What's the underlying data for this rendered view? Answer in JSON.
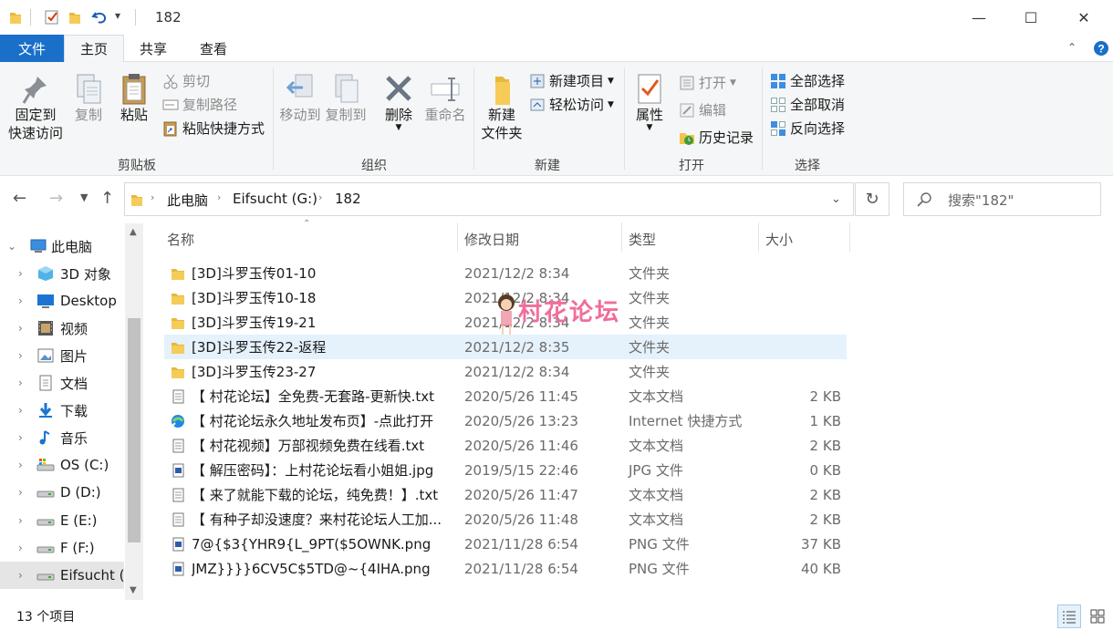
{
  "window": {
    "title": "182",
    "quick_access_dropdown": "▾",
    "controls": {
      "minimize": "—",
      "maximize": "☐",
      "close": "✕"
    }
  },
  "menu": {
    "file": "文件",
    "tabs": [
      "主页",
      "共享",
      "查看"
    ],
    "active_tab": "主页"
  },
  "ribbon": {
    "clipboard": {
      "pin_label_1": "固定到",
      "pin_label_2": "快速访问",
      "copy": "复制",
      "paste": "粘贴",
      "cut": "剪切",
      "copy_path": "复制路径",
      "paste_shortcut": "粘贴快捷方式",
      "group_label": "剪贴板"
    },
    "organize": {
      "move_to": "移动到",
      "copy_to": "复制到",
      "delete": "删除",
      "rename": "重命名",
      "group_label": "组织"
    },
    "new": {
      "new_folder_1": "新建",
      "new_folder_2": "文件夹",
      "new_item": "新建项目",
      "easy_access": "轻松访问",
      "group_label": "新建"
    },
    "open": {
      "properties": "属性",
      "open": "打开",
      "edit": "编辑",
      "history": "历史记录",
      "group_label": "打开"
    },
    "select": {
      "select_all": "全部选择",
      "select_none": "全部取消",
      "invert": "反向选择",
      "group_label": "选择"
    }
  },
  "address": {
    "breadcrumb": [
      "此电脑",
      "Eifsucht (G:)",
      "182"
    ],
    "search_placeholder": "搜索\"182\""
  },
  "nav_pane": {
    "items": [
      {
        "label": "此电脑",
        "icon": "computer-icon"
      },
      {
        "label": "3D 对象",
        "icon": "3d-objects-icon"
      },
      {
        "label": "Desktop",
        "icon": "desktop-icon"
      },
      {
        "label": "视频",
        "icon": "video-icon"
      },
      {
        "label": "图片",
        "icon": "pictures-icon"
      },
      {
        "label": "文档",
        "icon": "documents-icon"
      },
      {
        "label": "下载",
        "icon": "download-icon"
      },
      {
        "label": "音乐",
        "icon": "music-icon"
      },
      {
        "label": "OS (C:)",
        "icon": "drive-c-icon"
      },
      {
        "label": "D (D:)",
        "icon": "drive-icon"
      },
      {
        "label": "E (E:)",
        "icon": "drive-icon"
      },
      {
        "label": "F (F:)",
        "icon": "drive-icon"
      },
      {
        "label": "Eifsucht (G:)",
        "icon": "drive-icon"
      }
    ]
  },
  "columns": {
    "name": "名称",
    "date": "修改日期",
    "type": "类型",
    "size": "大小"
  },
  "files": [
    {
      "name": "[3D]斗罗玉传01-10",
      "date": "2021/12/2 8:34",
      "type": "文件夹",
      "size": "",
      "icon": "folder-icon"
    },
    {
      "name": "[3D]斗罗玉传10-18",
      "date": "2021/12/2 8:34",
      "type": "文件夹",
      "size": "",
      "icon": "folder-icon"
    },
    {
      "name": "[3D]斗罗玉传19-21",
      "date": "2021/12/2 8:34",
      "type": "文件夹",
      "size": "",
      "icon": "folder-icon"
    },
    {
      "name": "[3D]斗罗玉传22-返程",
      "date": "2021/12/2 8:35",
      "type": "文件夹",
      "size": "",
      "icon": "folder-icon"
    },
    {
      "name": "[3D]斗罗玉传23-27",
      "date": "2021/12/2 8:34",
      "type": "文件夹",
      "size": "",
      "icon": "folder-icon"
    },
    {
      "name": "【 村花论坛】全免费-无套路-更新快.txt",
      "date": "2020/5/26 11:45",
      "type": "文本文档",
      "size": "2 KB",
      "icon": "text-file-icon"
    },
    {
      "name": "【 村花论坛永久地址发布页】-点此打开",
      "date": "2020/5/26 13:23",
      "type": "Internet 快捷方式",
      "size": "1 KB",
      "icon": "internet-shortcut-icon"
    },
    {
      "name": "【 村花视频】万部视频免费在线看.txt",
      "date": "2020/5/26 11:46",
      "type": "文本文档",
      "size": "2 KB",
      "icon": "text-file-icon"
    },
    {
      "name": "【 解压密码】：上村花论坛看小姐姐.jpg",
      "date": "2019/5/15 22:46",
      "type": "JPG 文件",
      "size": "0 KB",
      "icon": "image-file-icon"
    },
    {
      "name": "【 来了就能下载的论坛，纯免费！】.txt",
      "date": "2020/5/26 11:47",
      "type": "文本文档",
      "size": "2 KB",
      "icon": "text-file-icon"
    },
    {
      "name": "【 有种子却没速度？来村花论坛人工加...",
      "date": "2020/5/26 11:48",
      "type": "文本文档",
      "size": "2 KB",
      "icon": "text-file-icon"
    },
    {
      "name": "7@{$3{YHR9{L_9PT($5OWNK.png",
      "date": "2021/11/28 6:54",
      "type": "PNG 文件",
      "size": "37 KB",
      "icon": "image-file-icon"
    },
    {
      "name": "JMZ}}}}6CV5C$5TD@~{4IHA.png",
      "date": "2021/11/28 6:54",
      "type": "PNG 文件",
      "size": "40 KB",
      "icon": "image-file-icon"
    }
  ],
  "selected_index": 3,
  "watermark": {
    "text": "村花论坛"
  },
  "status": {
    "count": "13 个项目"
  },
  "colors": {
    "accent": "#1a6fc9",
    "selection": "#e5f1fb",
    "folder": "#f4c542"
  }
}
